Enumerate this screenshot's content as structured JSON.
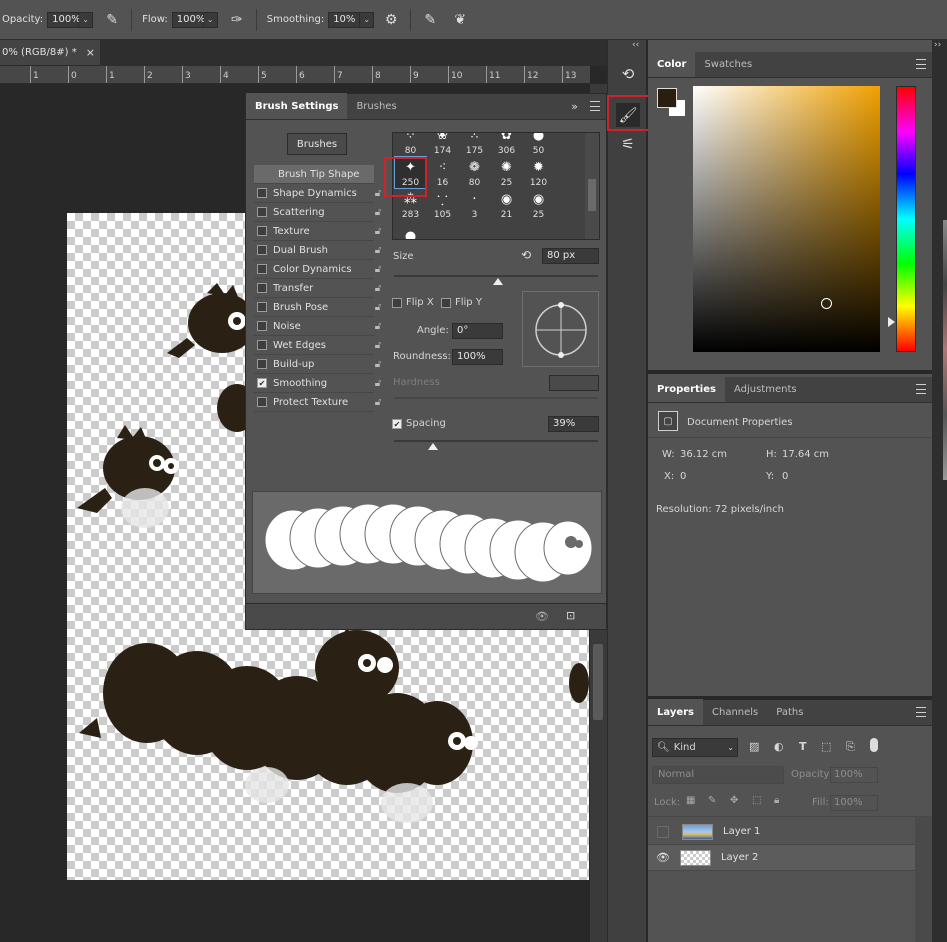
{
  "options_bar": {
    "opacity_label": "Opacity:",
    "opacity_value": "100%",
    "flow_label": "Flow:",
    "flow_value": "100%",
    "smoothing_label": "Smoothing:",
    "smoothing_value": "10%"
  },
  "document": {
    "tab_title": "0% (RGB/8#) *",
    "close_glyph": "×"
  },
  "ruler": {
    "ticks": [
      "1",
      "0",
      "1",
      "2",
      "3",
      "4",
      "5",
      "6",
      "7",
      "8",
      "9",
      "10",
      "11",
      "12",
      "13"
    ]
  },
  "brush_settings": {
    "tabs": [
      "Brush Settings",
      "Brushes"
    ],
    "brushes_button": "Brushes",
    "categories": [
      {
        "label": "Brush Tip Shape",
        "checkbox": false,
        "checked": false
      },
      {
        "label": "Shape Dynamics",
        "checkbox": true,
        "checked": false
      },
      {
        "label": "Scattering",
        "checkbox": true,
        "checked": false
      },
      {
        "label": "Texture",
        "checkbox": true,
        "checked": false
      },
      {
        "label": "Dual Brush",
        "checkbox": true,
        "checked": false
      },
      {
        "label": "Color Dynamics",
        "checkbox": true,
        "checked": false
      },
      {
        "label": "Transfer",
        "checkbox": true,
        "checked": false
      },
      {
        "label": "Brush Pose",
        "checkbox": true,
        "checked": false
      },
      {
        "label": "Noise",
        "checkbox": true,
        "checked": false
      },
      {
        "label": "Wet Edges",
        "checkbox": true,
        "checked": false
      },
      {
        "label": "Build-up",
        "checkbox": true,
        "checked": false
      },
      {
        "label": "Smoothing",
        "checkbox": true,
        "checked": true
      },
      {
        "label": "Protect Texture",
        "checkbox": true,
        "checked": false
      }
    ],
    "tips": [
      "80",
      "174",
      "175",
      "306",
      "50",
      "250",
      "16",
      "80",
      "25",
      "120",
      "283",
      "105",
      "3",
      "21",
      "25"
    ],
    "selected_tip": "250",
    "size_label": "Size",
    "size_value": "80 px",
    "size_percent": 51,
    "flip_x": "Flip X",
    "flip_y": "Flip Y",
    "angle_label": "Angle:",
    "angle_value": "0°",
    "roundness_label": "Roundness:",
    "roundness_value": "100%",
    "hardness_label": "Hardness",
    "spacing_label": "Spacing",
    "spacing_value": "39%",
    "spacing_checked": true,
    "spacing_percent": 19
  },
  "color_panel": {
    "tabs": [
      "Color",
      "Swatches"
    ],
    "foreground": "#2a1e0e",
    "background": "#ffffff",
    "hue_color": "#f0a000"
  },
  "properties": {
    "tabs": [
      "Properties",
      "Adjustments"
    ],
    "title": "Document Properties",
    "w_label": "W:",
    "w_value": "36.12 cm",
    "h_label": "H:",
    "h_value": "17.64 cm",
    "x_label": "X:",
    "x_value": "0",
    "y_label": "Y:",
    "y_value": "0",
    "resolution": "Resolution: 72 pixels/inch"
  },
  "layers": {
    "tabs": [
      "Layers",
      "Channels",
      "Paths"
    ],
    "kind_label": "Kind",
    "blend_mode": "Normal",
    "opacity_label": "Opacity:",
    "opacity_value": "100%",
    "lock_label": "Lock:",
    "fill_label": "Fill:",
    "fill_value": "100%",
    "items": [
      {
        "name": "Layer 1",
        "visible": false
      },
      {
        "name": "Layer 2",
        "visible": true
      }
    ]
  }
}
